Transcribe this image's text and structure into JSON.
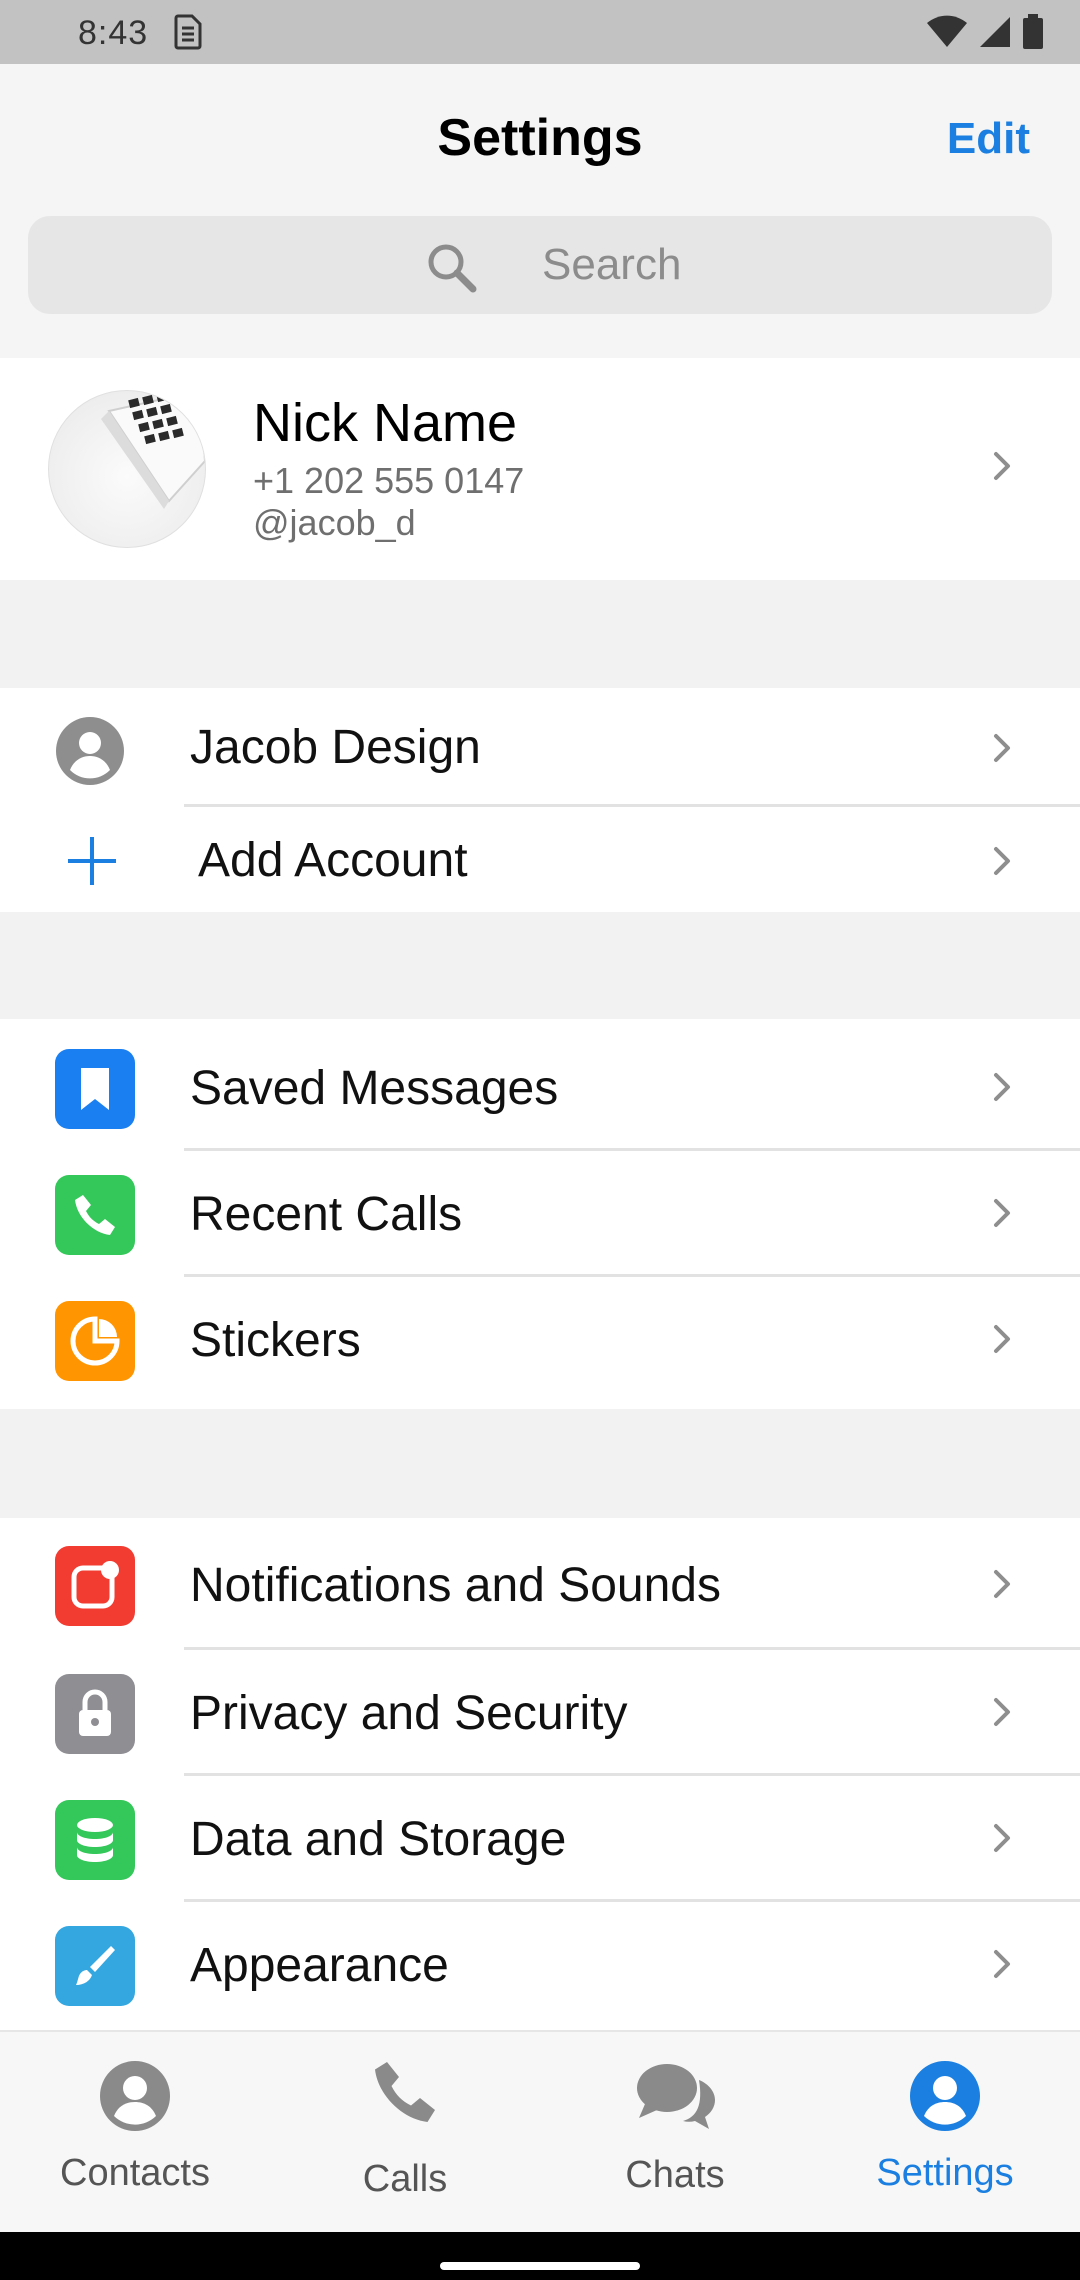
{
  "status": {
    "time": "8:43"
  },
  "header": {
    "title": "Settings",
    "edit_label": "Edit"
  },
  "search": {
    "placeholder": "Search"
  },
  "profile": {
    "name": "Nick Name",
    "phone": "+1 202 555 0147",
    "username": "@jacob_d"
  },
  "accounts": [
    {
      "label": "Jacob Design",
      "icon": "account-circle-icon"
    },
    {
      "label": "Add Account",
      "icon": "plus-icon"
    }
  ],
  "group1": [
    {
      "label": "Saved Messages",
      "icon": "bookmark-icon",
      "color": "#1a7ff0"
    },
    {
      "label": "Recent Calls",
      "icon": "phone-icon",
      "color": "#34c759"
    },
    {
      "label": "Stickers",
      "icon": "sticker-icon",
      "color": "#ff9500"
    }
  ],
  "group2": [
    {
      "label": "Notifications and Sounds",
      "icon": "notification-icon",
      "color": "#f23c32"
    },
    {
      "label": "Privacy and Security",
      "icon": "lock-icon",
      "color": "#8e8e93"
    },
    {
      "label": "Data and Storage",
      "icon": "database-icon",
      "color": "#34c759"
    },
    {
      "label": "Appearance",
      "icon": "brush-icon",
      "color": "#35a7e0"
    }
  ],
  "tabs": [
    {
      "label": "Contacts",
      "icon": "contacts-icon"
    },
    {
      "label": "Calls",
      "icon": "calls-icon"
    },
    {
      "label": "Chats",
      "icon": "chats-icon"
    },
    {
      "label": "Settings",
      "icon": "settings-icon",
      "active": true
    }
  ],
  "colors": {
    "accent": "#1a7fe0",
    "inactive_tab": "#8a8a8a"
  }
}
